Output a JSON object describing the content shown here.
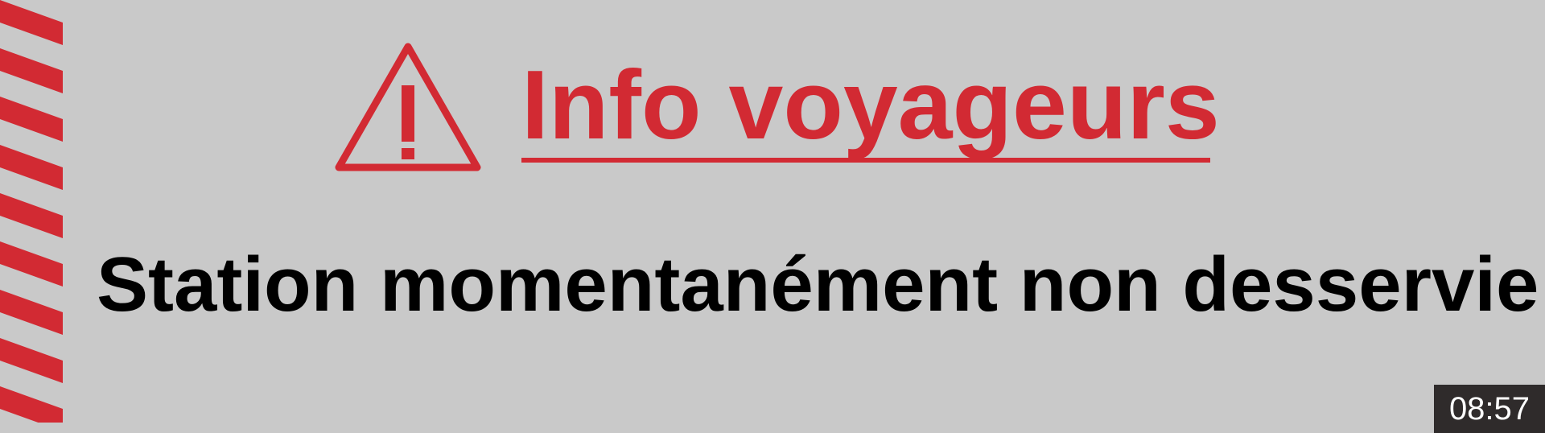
{
  "sign": {
    "title": "Info voyageurs",
    "message": "Station momentanément non desservie",
    "icon": "warning-triangle-icon"
  },
  "overlay": {
    "timestamp": "08:57"
  },
  "colors": {
    "background": "#c9c9c9",
    "accent_red": "#d22a33",
    "message_text": "#000000",
    "timestamp_bg": "#2f2b2b",
    "timestamp_text": "#ffffff"
  }
}
